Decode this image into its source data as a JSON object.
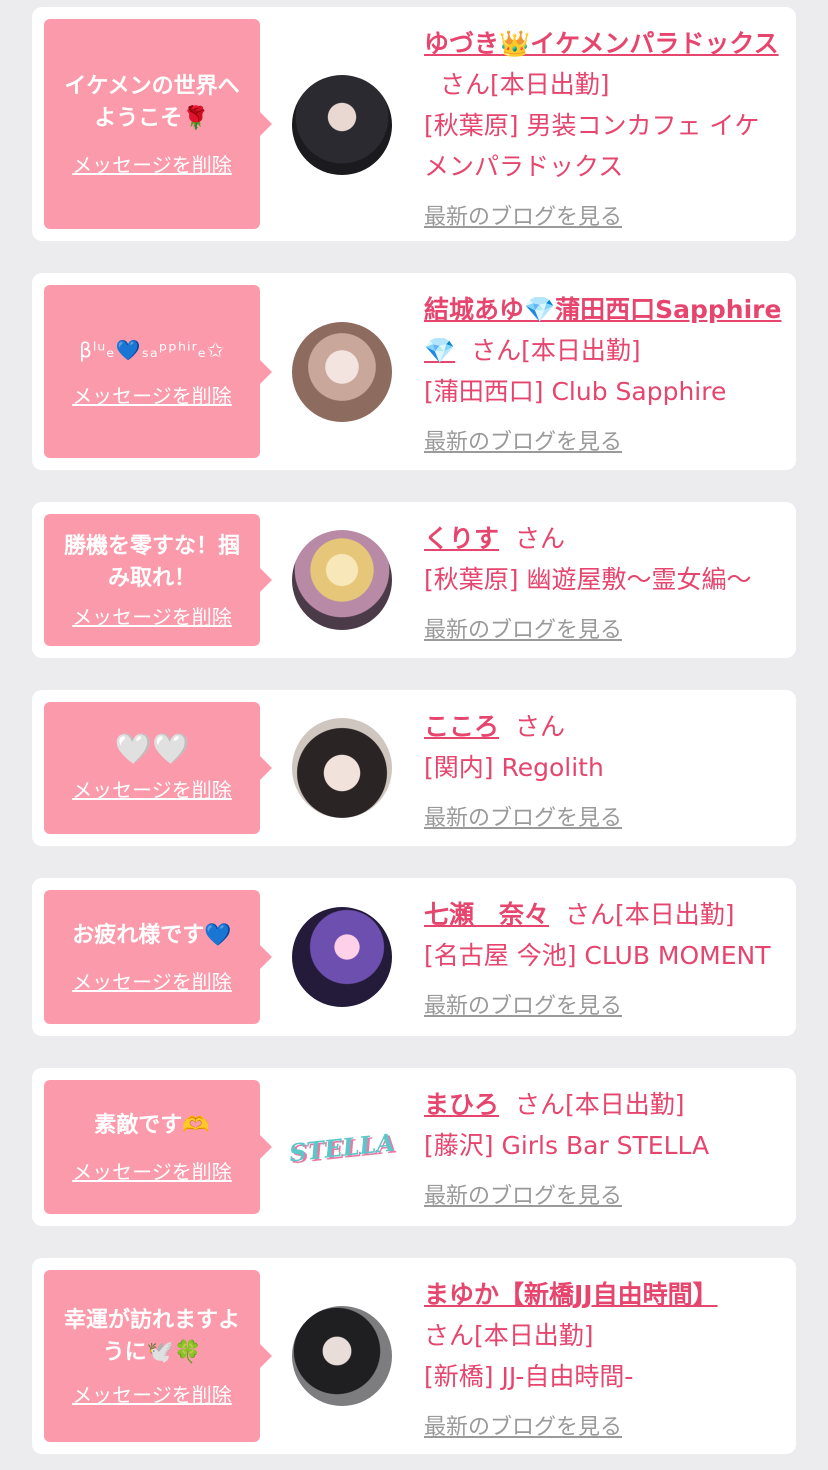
{
  "delete_label": "メッセージを削除",
  "blog_label": "最新のブログを見る",
  "colors": {
    "bubble": "#fb9aab",
    "accent": "#e6456e",
    "background": "#ececef"
  },
  "cards": [
    {
      "message": "イケメンの世界へようこそ🌹",
      "name": "ゆづき👑イケメンパラドックス",
      "suffix": "さん[本日出勤]",
      "shop": "[秋葉原] 男装コンカフェ イケメンパラドックス",
      "avatar": "photo-dark-hair-man"
    },
    {
      "message": "βˡᵘₑ💙ₛₐᵖᵖʰⁱʳₑ✩",
      "name": "結城あゆ💎蒲田西口Sapphire💎",
      "suffix": "さん[本日出勤]",
      "shop": "[蒲田西口] Club Sapphire",
      "avatar": "photo-blonde-woman"
    },
    {
      "message": "勝機を零すな！掴み取れ！",
      "name": "くりす",
      "suffix": "さん",
      "shop": "[秋葉原] 幽遊屋敷〜霊女編〜",
      "avatar": "photo-blonde-cosplay"
    },
    {
      "message": "🤍🤍",
      "name": "こころ",
      "suffix": "さん",
      "shop": "[関内] Regolith",
      "avatar": "photo-dark-hair-woman"
    },
    {
      "message": "お疲れ様です💙",
      "name": "七瀬　奈々",
      "suffix": "さん[本日出勤]",
      "shop": "[名古屋 今池] CLUB MOMENT",
      "avatar": "photo-purple-light"
    },
    {
      "message": "素敵です🫶",
      "name": "まひろ",
      "suffix": "さん[本日出勤]",
      "shop": "[藤沢] Girls Bar STELLA",
      "avatar": "stella-logo",
      "logo_text": "STELLA"
    },
    {
      "message": "幸運が訪れますように🕊️🍀",
      "name": "まゆか【新橋JJ自由時間】",
      "suffix": "さん[本日出勤]",
      "shop": "[新橋] JJ-自由時間-",
      "avatar": "photo-black-hair-woman"
    }
  ]
}
